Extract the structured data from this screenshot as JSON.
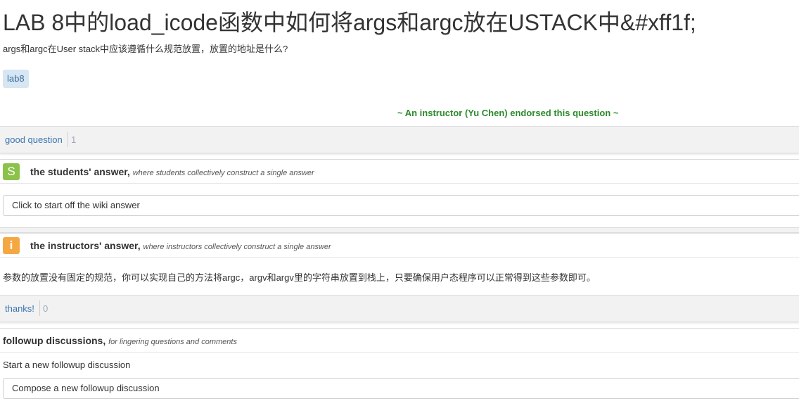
{
  "question": {
    "title": "LAB 8中的load_icode函数中如何将args和argc放在USTACK中&#xff1f;",
    "body": "args和argc在User stack中应该遵循什么规范放置，放置的地址是什么?",
    "tag": "lab8",
    "endorsement": "~ An instructor (Yu Chen) endorsed this question ~",
    "good_question_label": "good question",
    "good_question_count": "1"
  },
  "students_answer": {
    "badge": "S",
    "title": "the students' answer,",
    "subtitle": "where students collectively construct a single answer",
    "wiki_placeholder": "Click to start off the wiki answer"
  },
  "instructors_answer": {
    "badge": "i",
    "title": "the instructors' answer,",
    "subtitle": "where instructors collectively construct a single answer",
    "body": "参数的放置没有固定的规范，你可以实现自己的方法将argc，argv和argv里的字符串放置到栈上，只要确保用户态程序可以正常得到这些参数即可。",
    "thanks_label": "thanks!",
    "thanks_count": "0"
  },
  "followup": {
    "title": "followup discussions,",
    "subtitle": "for lingering questions and comments",
    "start_label": "Start a new followup discussion",
    "compose_placeholder": "Compose a new followup discussion"
  },
  "colors": {
    "tag_bg": "#d6e6f3",
    "endorse_green": "#2c8a2c",
    "students_badge": "#8bc34a",
    "instructors_badge": "#f5a742",
    "link_blue": "#3a75b0"
  }
}
